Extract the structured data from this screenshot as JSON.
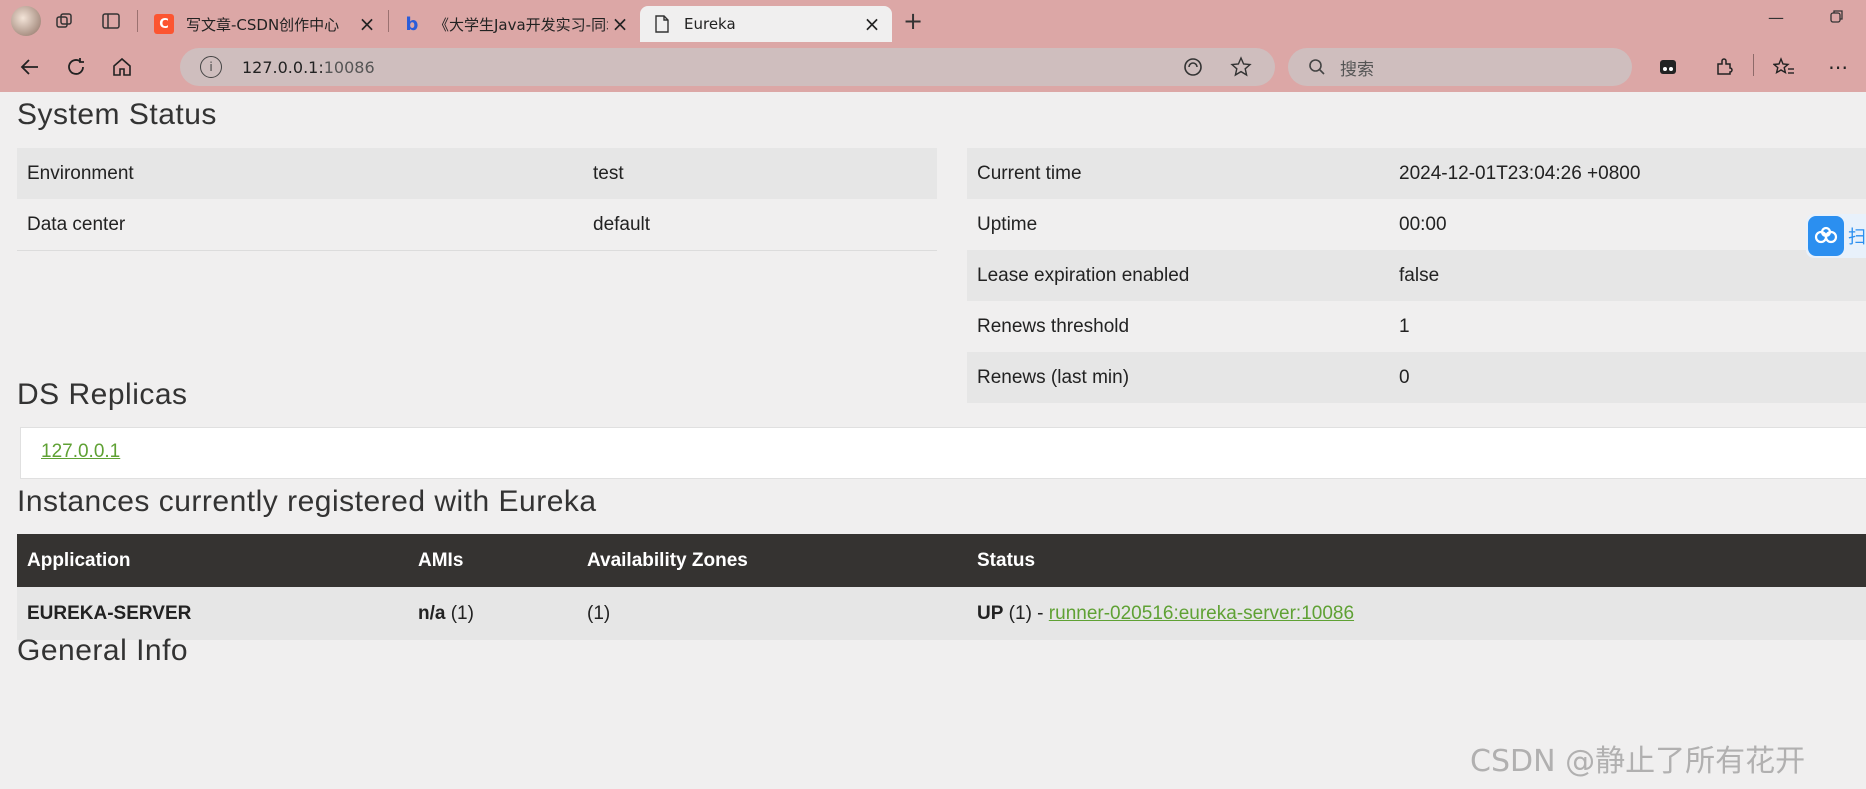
{
  "browser": {
    "tabs": [
      {
        "title": "写文章-CSDN创作中心",
        "favicon": "C",
        "favicon_color": "#fc5531"
      },
      {
        "title": "《大学生Java开发实习-同城拼车系",
        "favicon": "b",
        "favicon_color": "#2b5cd9"
      },
      {
        "title": "Eureka",
        "favicon": "page-icon",
        "favicon_color": "#333333"
      }
    ],
    "address": {
      "host": "127.0.0.1:",
      "port": "10086"
    },
    "search_placeholder": "搜索"
  },
  "page": {
    "system_status_heading": "System Status",
    "left_table": [
      {
        "key": "Environment",
        "value": "test"
      },
      {
        "key": "Data center",
        "value": "default"
      }
    ],
    "right_table": [
      {
        "key": "Current time",
        "value": "2024-12-01T23:04:26 +0800"
      },
      {
        "key": "Uptime",
        "value": "00:00"
      },
      {
        "key": "Lease expiration enabled",
        "value": "false"
      },
      {
        "key": "Renews threshold",
        "value": "1"
      },
      {
        "key": "Renews (last min)",
        "value": "0"
      }
    ],
    "ds_replicas_heading": "DS Replicas",
    "replica_link": "127.0.0.1",
    "instances_heading": "Instances currently registered with Eureka",
    "instances_columns": [
      "Application",
      "AMIs",
      "Availability Zones",
      "Status"
    ],
    "instances_rows": [
      {
        "application": "EUREKA-SERVER",
        "amis_bold": "n/a",
        "amis_count": " (1)",
        "zones": "(1)",
        "status_prefix_bold": "UP",
        "status_prefix": " (1) - ",
        "status_link": "runner-020516:eureka-server:10086"
      }
    ],
    "general_info_heading": "General Info"
  },
  "watermark": "CSDN @静止了所有花开",
  "side_badge_text": "扫"
}
